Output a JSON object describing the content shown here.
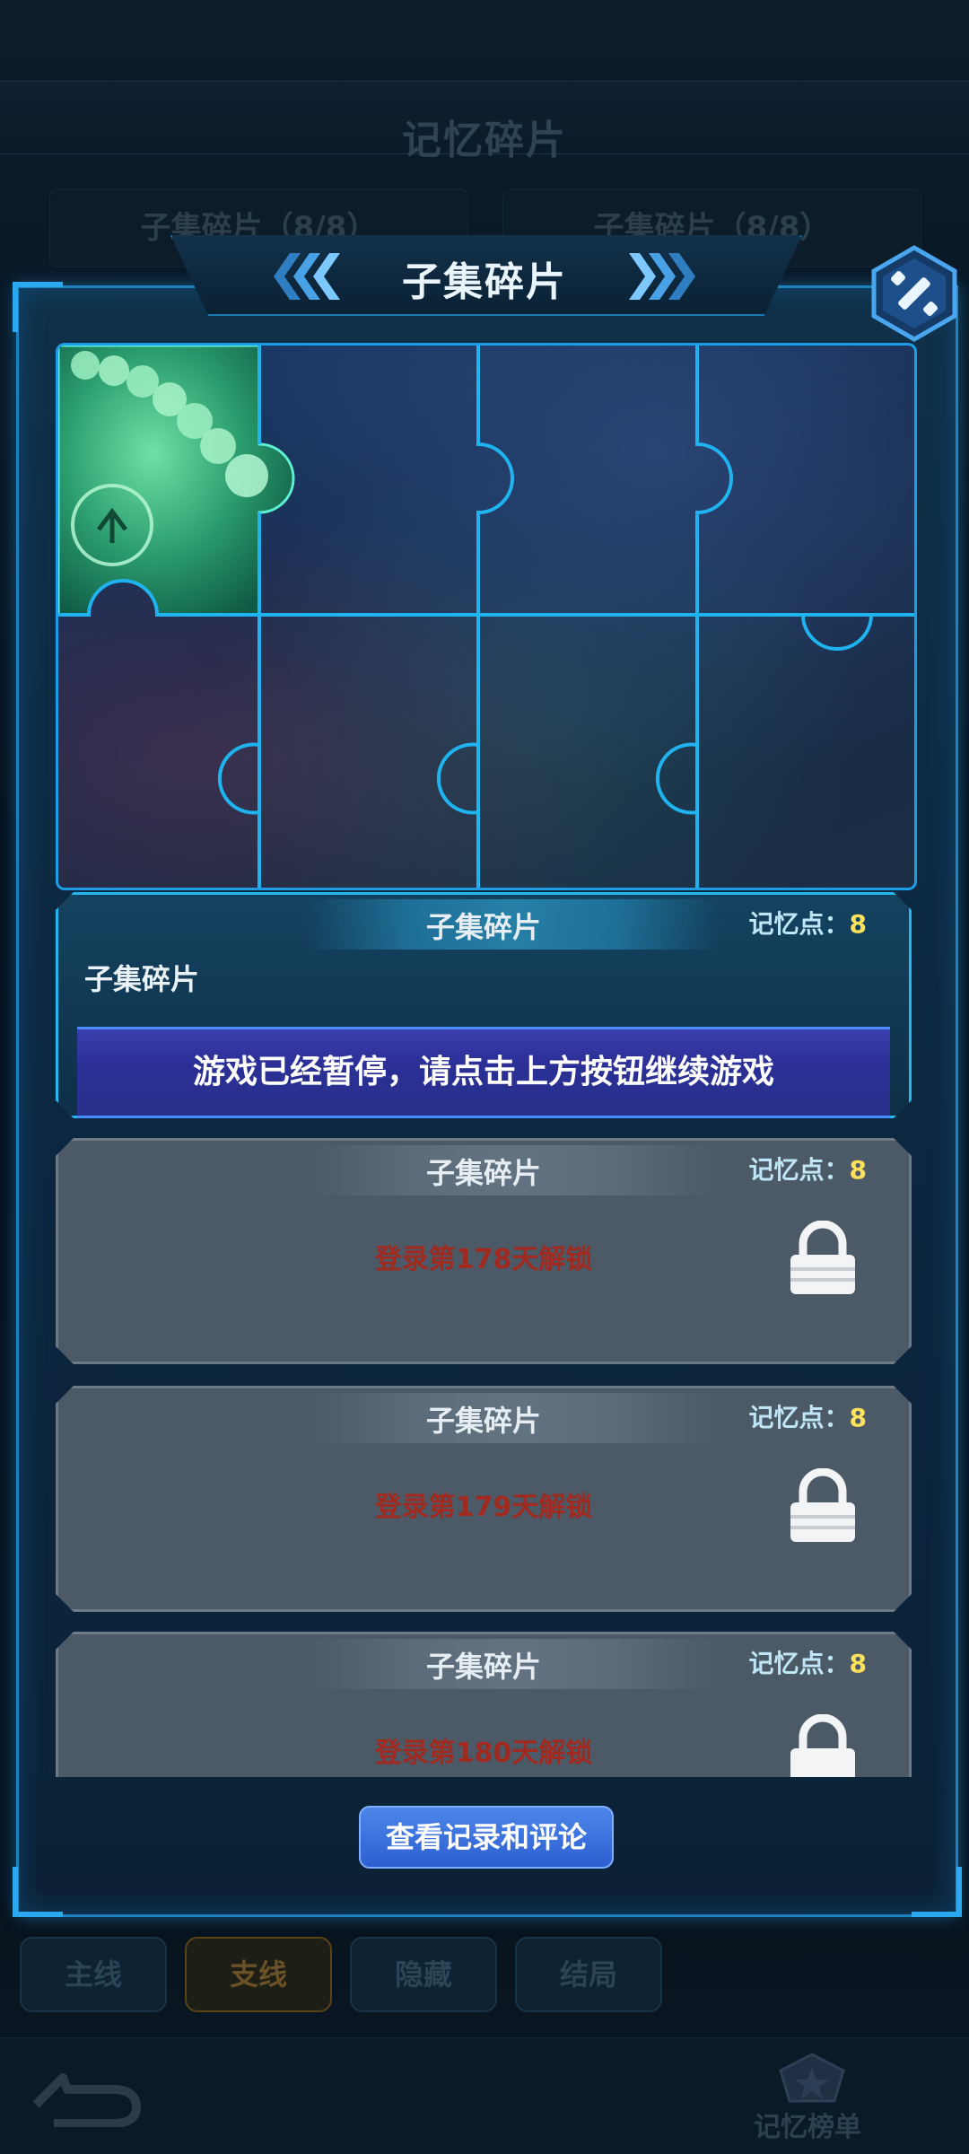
{
  "background": {
    "page_title": "记忆碎片",
    "tabs": [
      "子集碎片（8/8）",
      "子集碎片（8/8）"
    ],
    "bottom_tabs": [
      "主线",
      "支线",
      "隐藏",
      "结局"
    ],
    "rank_label": "记忆榜单"
  },
  "modal": {
    "title": "子集碎片",
    "record_button": "查看记录和评论",
    "puzzle": {
      "pieces_total": 8,
      "pieces_unlocked": 1
    },
    "cards": [
      {
        "title": "子集碎片",
        "mem_label": "记忆点：",
        "mem_value": "8",
        "desc": "子集碎片",
        "banner": "游戏已经暂停，请点击上方按钮继续游戏"
      },
      {
        "title": "子集碎片",
        "mem_label": "记忆点：",
        "mem_value": "8",
        "unlock": "登录第178天解锁"
      },
      {
        "title": "子集碎片",
        "mem_label": "记忆点：",
        "mem_value": "8",
        "unlock": "登录第179天解锁"
      },
      {
        "title": "子集碎片",
        "mem_label": "记忆点：",
        "mem_value": "8",
        "unlock": "登录第180天解锁"
      }
    ]
  },
  "colors": {
    "accent": "#1d9de3",
    "memory_value": "#ffe25a",
    "unlock_text": "#a02a20",
    "locked_card": "#4c5966"
  },
  "icons": [
    "chevron-left-icon",
    "chevron-right-icon",
    "close-icon",
    "lock-icon",
    "back-arrow-icon",
    "rank-badge-icon"
  ]
}
